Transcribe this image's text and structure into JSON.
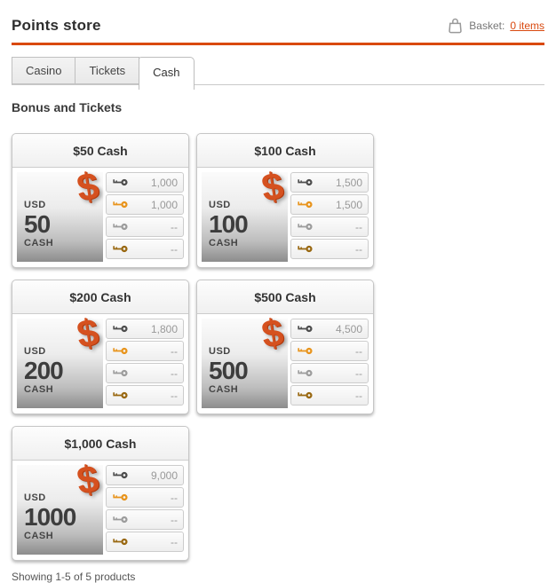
{
  "header": {
    "title": "Points store",
    "basket_label": "Basket:",
    "basket_count": "0 items"
  },
  "tabs": [
    {
      "label": "Casino",
      "active": false
    },
    {
      "label": "Tickets",
      "active": false
    },
    {
      "label": "Cash",
      "active": true
    }
  ],
  "section": {
    "heading": "Bonus and Tickets"
  },
  "products": [
    {
      "title": "$50 Cash",
      "symbol": "$",
      "currency": "USD",
      "amount": "50",
      "unit": "CASH",
      "prices": [
        {
          "key": "black",
          "value": "1,000"
        },
        {
          "key": "gold",
          "value": "1,000"
        },
        {
          "key": "silver",
          "value": "--"
        },
        {
          "key": "bronze",
          "value": "--"
        }
      ]
    },
    {
      "title": "$100 Cash",
      "symbol": "$",
      "currency": "USD",
      "amount": "100",
      "unit": "CASH",
      "prices": [
        {
          "key": "black",
          "value": "1,500"
        },
        {
          "key": "gold",
          "value": "1,500"
        },
        {
          "key": "silver",
          "value": "--"
        },
        {
          "key": "bronze",
          "value": "--"
        }
      ]
    },
    {
      "title": "$200 Cash",
      "symbol": "$",
      "currency": "USD",
      "amount": "200",
      "unit": "CASH",
      "prices": [
        {
          "key": "black",
          "value": "1,800"
        },
        {
          "key": "gold",
          "value": "--"
        },
        {
          "key": "silver",
          "value": "--"
        },
        {
          "key": "bronze",
          "value": "--"
        }
      ]
    },
    {
      "title": "$500 Cash",
      "symbol": "$",
      "currency": "USD",
      "amount": "500",
      "unit": "CASH",
      "prices": [
        {
          "key": "black",
          "value": "4,500"
        },
        {
          "key": "gold",
          "value": "--"
        },
        {
          "key": "silver",
          "value": "--"
        },
        {
          "key": "bronze",
          "value": "--"
        }
      ]
    },
    {
      "title": "$1,000 Cash",
      "symbol": "$",
      "currency": "USD",
      "amount": "1000",
      "unit": "CASH",
      "prices": [
        {
          "key": "black",
          "value": "9,000"
        },
        {
          "key": "gold",
          "value": "--"
        },
        {
          "key": "silver",
          "value": "--"
        },
        {
          "key": "bronze",
          "value": "--"
        }
      ]
    }
  ],
  "footer": {
    "showing": "Showing 1-5 of 5 products"
  },
  "colors": {
    "accent": "#d9490f",
    "dollar": "#d5511f",
    "key_black": "#4d4d4d",
    "key_gold": "#e8941c",
    "key_silver": "#9c9c9c",
    "key_bronze": "#996811"
  }
}
